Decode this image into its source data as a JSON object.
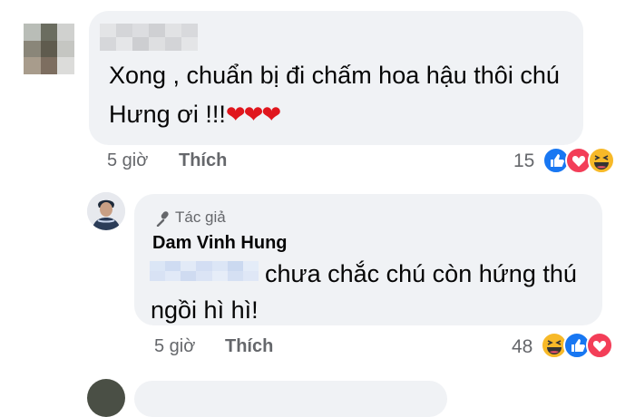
{
  "comment1": {
    "text": "Xong , chuẩn bị đi chấm hoa hậu thôi chú Hưng ơi !!!",
    "hearts": "❤❤❤",
    "time": "5 giờ",
    "like_label": "Thích",
    "reaction_count": "15",
    "reactions": [
      "like-icon",
      "love-icon",
      "haha-icon"
    ]
  },
  "comment2": {
    "author_badge": "Tác giả",
    "author_name": "Dam Vinh Hung",
    "text": "chưa chắc chú còn hứng thú ngồi hì hì!",
    "time": "5 giờ",
    "like_label": "Thích",
    "reaction_count": "48",
    "reactions": [
      "haha-icon",
      "like-icon",
      "love-icon"
    ]
  },
  "colors": {
    "bubble": "#f0f2f5",
    "meta_text": "#65676b",
    "like_blue": "#1877f2",
    "love_red": "#f33e58",
    "haha_yellow": "#f7b928"
  }
}
